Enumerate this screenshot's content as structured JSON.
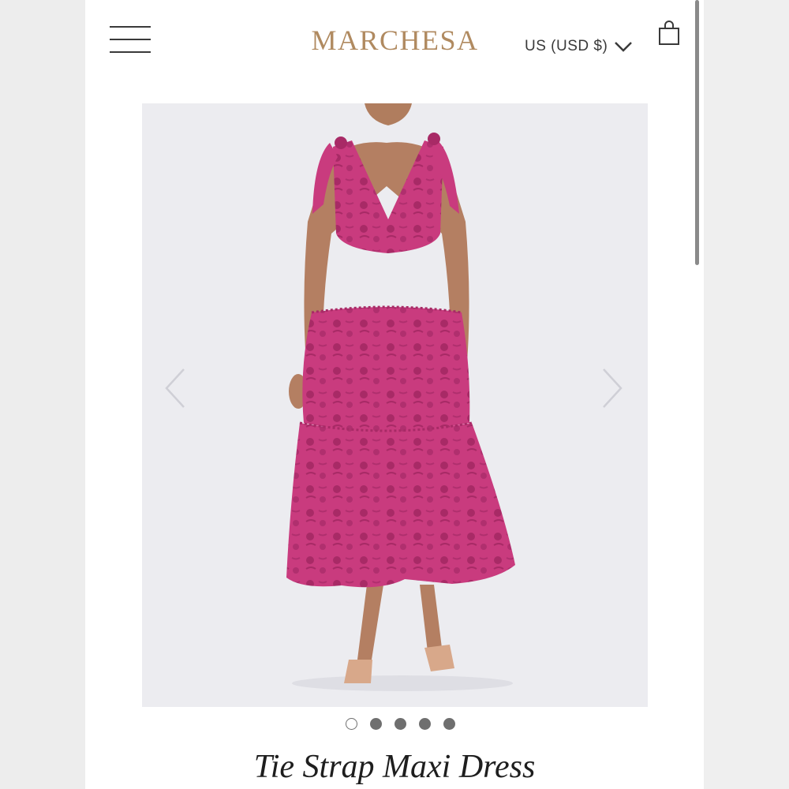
{
  "header": {
    "brand": "MARCHESA",
    "currency_label": "US (USD $)",
    "menu_icon": "hamburger-menu-icon",
    "cart_icon": "shopping-bag-icon"
  },
  "gallery": {
    "image_alt": "Model wearing pink tiered floral maxi dress",
    "slide_count": 5,
    "active_index": 0
  },
  "product": {
    "title": "Tie Strap Maxi Dress"
  },
  "colors": {
    "brand": "#b08a60",
    "dress": "#c93b7e",
    "dress_shadow": "#a82a66",
    "background": "#ececf0"
  }
}
